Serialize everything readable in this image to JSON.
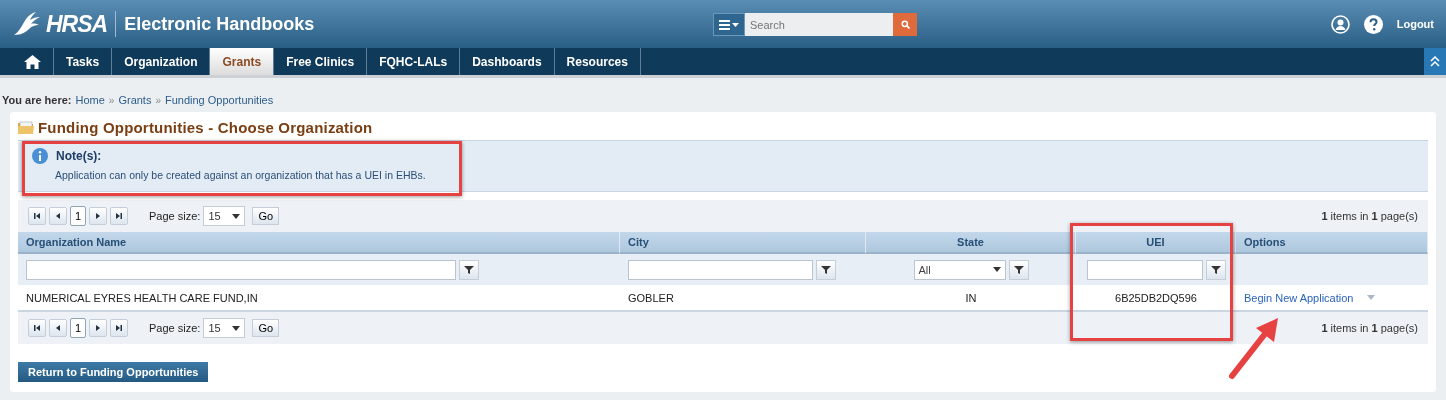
{
  "header": {
    "logo": "HRSA",
    "app_title": "Electronic Handbooks",
    "search": {
      "placeholder": "Search"
    },
    "logout": "Logout"
  },
  "nav": {
    "items": [
      {
        "kind": "home",
        "selected": false
      },
      {
        "kind": "text",
        "label": "Tasks",
        "selected": false
      },
      {
        "kind": "text",
        "label": "Organization",
        "selected": false
      },
      {
        "kind": "text",
        "label": "Grants",
        "selected": true
      },
      {
        "kind": "text",
        "label": "Free Clinics",
        "selected": false
      },
      {
        "kind": "text",
        "label": "FQHC-LALs",
        "selected": false
      },
      {
        "kind": "text",
        "label": "Dashboards",
        "selected": false
      },
      {
        "kind": "text",
        "label": "Resources",
        "selected": false
      }
    ]
  },
  "breadcrumb": {
    "prefix": "You are here:",
    "separator": "»",
    "items": [
      "Home",
      "Grants",
      "Funding Opportunities"
    ]
  },
  "page_title": "Funding Opportunities - Choose Organization",
  "note": {
    "title": "Note(s):",
    "text": "Application can only be created against an organization that has a UEI in EHBs.",
    "highlighted": true
  },
  "pager_top": {
    "page": "1",
    "page_size_label": "Page size:",
    "page_size": "15",
    "go": "Go",
    "summary": "**1** items in **1** page(s)"
  },
  "table": {
    "uei_highlighted": true,
    "columns": [
      {
        "label": "Organization Name",
        "kind": "text"
      },
      {
        "label": "City",
        "kind": "text"
      },
      {
        "label": "State",
        "kind": "select",
        "filter_value": "All"
      },
      {
        "label": "UEI",
        "kind": "text"
      },
      {
        "label": "Options",
        "kind": "none"
      }
    ],
    "rows": [
      {
        "cells": [
          "NUMERICAL EYRES HEALTH CARE FUND,IN",
          "GOBLER",
          "IN",
          "6B25DB2DQ596"
        ],
        "option": "Begin New Application",
        "pointed": true
      }
    ]
  },
  "pager_bottom": {
    "page": "1",
    "page_size_label": "Page size:",
    "page_size": "15",
    "go": "Go",
    "summary": "**1** items in **1** page(s)"
  },
  "return_button": "Return to Funding Opportunities"
}
